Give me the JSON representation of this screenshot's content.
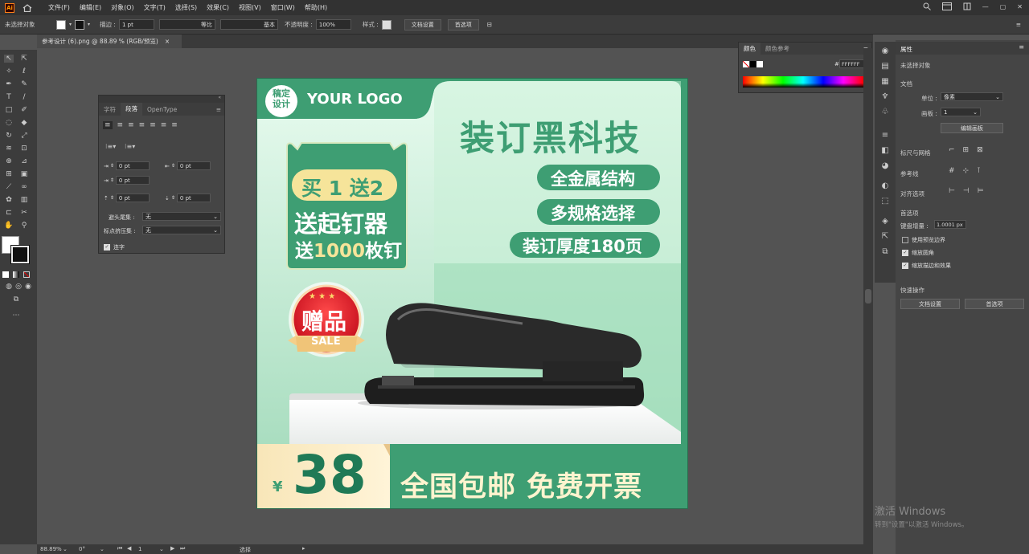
{
  "app": {
    "logo": "Ai",
    "menu": [
      "文件(F)",
      "编辑(E)",
      "对象(O)",
      "文字(T)",
      "选择(S)",
      "效果(C)",
      "视图(V)",
      "窗口(W)",
      "帮助(H)"
    ]
  },
  "control": {
    "no_selection": "未选择对象",
    "stroke_label": "描边 :",
    "stroke_value": "1 pt",
    "profile1": "等比",
    "profile2": "基本",
    "opacity_label": "不透明度 :",
    "opacity_value": "100%",
    "style_label": "样式 :",
    "doc_setup": "文档设置",
    "preferences": "首选项"
  },
  "tab": {
    "title": "参考设计 (6).png @ 88.89 % (RGB/预览)",
    "close": "×"
  },
  "para_panel": {
    "tabs": [
      "字符",
      "段落",
      "OpenType"
    ],
    "fields": [
      "0 pt",
      "0 pt",
      "0 pt",
      "0 pt",
      "0 pt"
    ],
    "avoid_label": "避头尾集 :",
    "avoid_value": "无",
    "punct_label": "标点挤压集 :",
    "punct_value": "无",
    "hyphen": "连字"
  },
  "color_panel": {
    "tabs": [
      "颜色",
      "颜色参考"
    ],
    "hex": "FFFFFF",
    "hash": "#"
  },
  "props": {
    "title": "属性",
    "no_selection": "未选择对象",
    "document": "文档",
    "units_label": "单位 :",
    "units_value": "像素",
    "artboard_label": "画板 :",
    "artboard_value": "1",
    "edit_artboard": "编辑画板",
    "rulers_grids": "标尺与网格",
    "guides": "参考线",
    "align_options": "对齐选项",
    "prefs": "首选项",
    "keyboard_inc_label": "键盘增量 :",
    "keyboard_inc_value": "1.0001 px",
    "cb1": "使用预览边界",
    "cb2": "缩放圆角",
    "cb3": "缩放描边和效果",
    "quick_actions": "快速操作",
    "doc_setup": "文档设置",
    "preferences": "首选项"
  },
  "status": {
    "zoom": "88.89%",
    "angle": "0°",
    "artboard": "1",
    "mode": "选择"
  },
  "watermark": {
    "line1": "激活 Windows",
    "line2": "转到\"设置\"以激活 Windows。"
  },
  "ad": {
    "badge": "稿定\n设计",
    "badge1": "稿定",
    "badge2": "设计",
    "logo": "YOUR LOGO",
    "headline": "装订黑科技",
    "features": [
      "全金属结构",
      "多规格选择",
      "装订厚度180页"
    ],
    "promo_top": "买 1 送2",
    "promo_mid": "送起钉器",
    "promo_bot_pre": "送",
    "promo_bot_num": "1000",
    "promo_bot_post": "枚钉",
    "gift": "赠品",
    "sale": "SALE",
    "currency": "¥",
    "price": "38",
    "slogan": "全国包邮 免费开票"
  }
}
